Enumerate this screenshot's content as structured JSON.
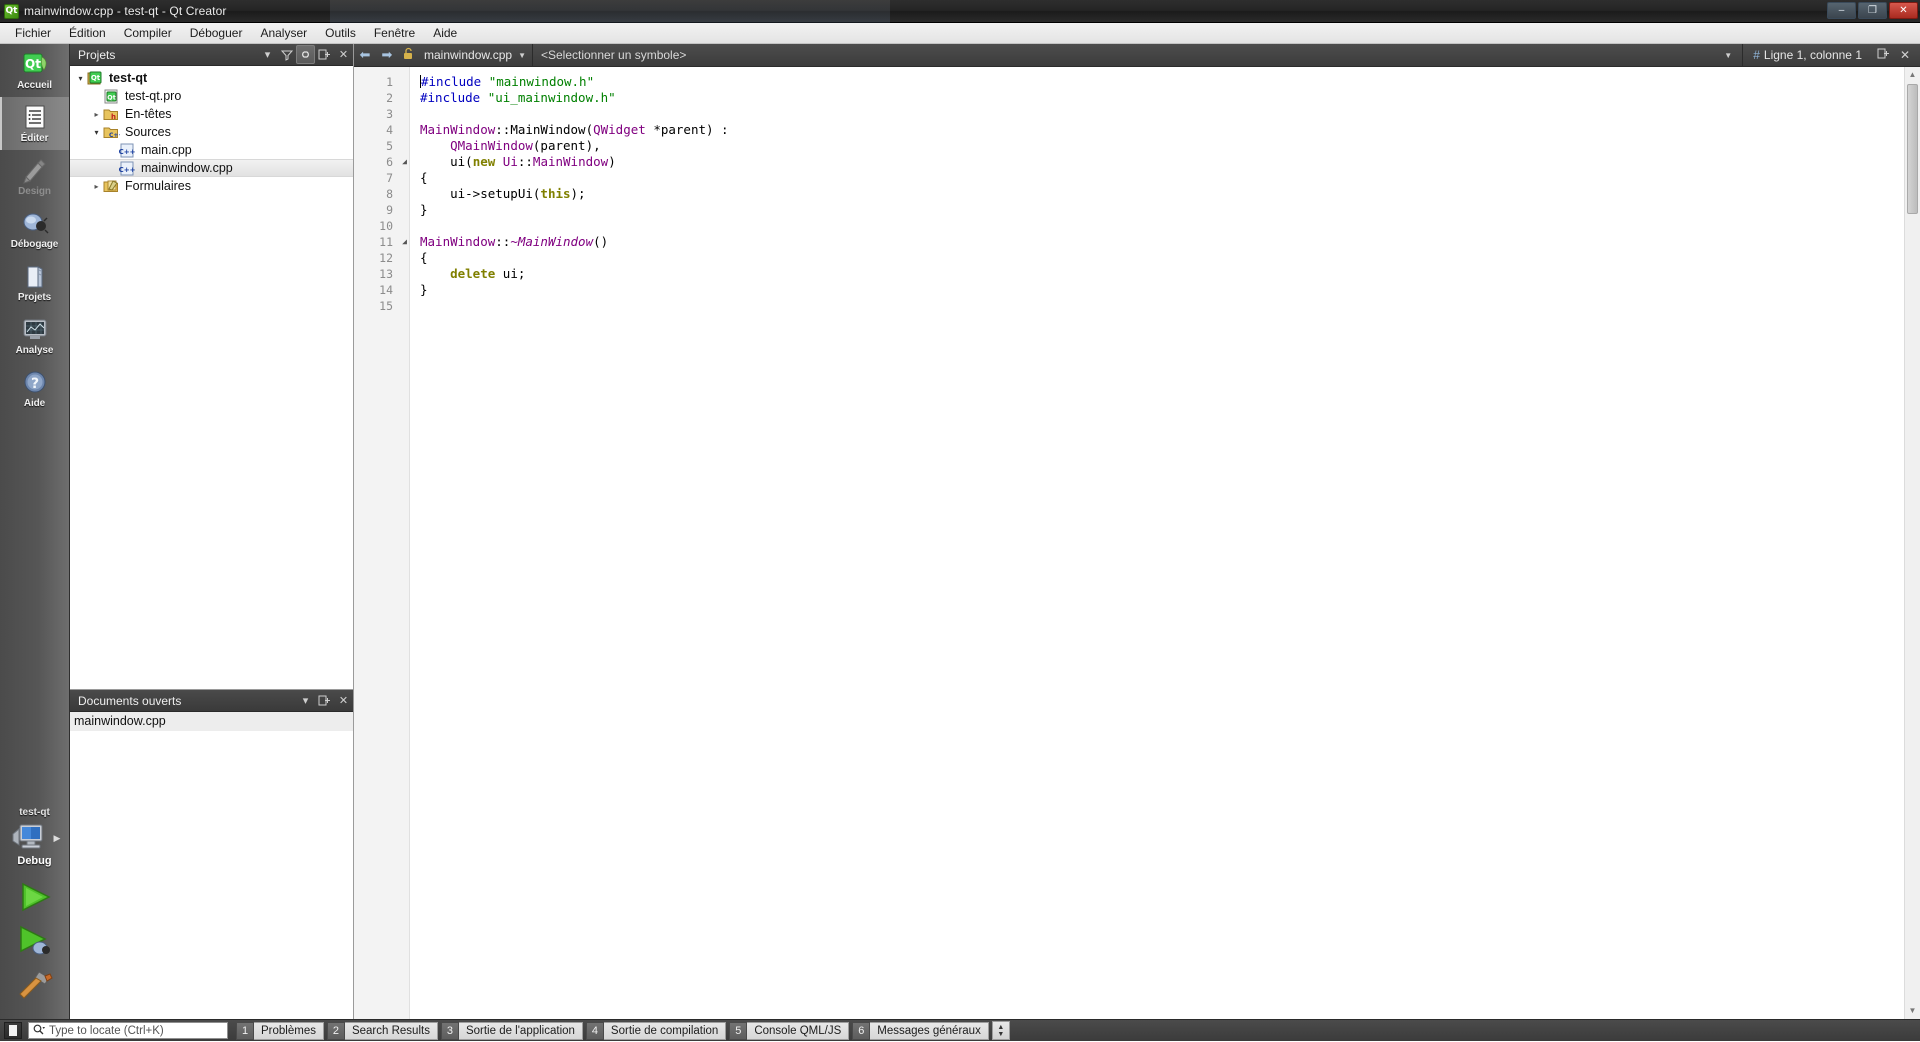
{
  "window": {
    "title": "mainwindow.cpp - test-qt - Qt Creator",
    "app_icon": "qt-logo-icon",
    "minimize_label": "–",
    "maximize_label": "❐",
    "close_label": "✕"
  },
  "menubar": {
    "items": [
      {
        "label": "Fichier"
      },
      {
        "label": "Édition"
      },
      {
        "label": "Compiler"
      },
      {
        "label": "Déboguer"
      },
      {
        "label": "Analyser"
      },
      {
        "label": "Outils"
      },
      {
        "label": "Fenêtre"
      },
      {
        "label": "Aide"
      }
    ]
  },
  "modebar": {
    "modes": [
      {
        "label": "Accueil",
        "icon": "qt-home-icon",
        "selected": false,
        "enabled": true
      },
      {
        "label": "Éditer",
        "icon": "document-edit-icon",
        "selected": true,
        "enabled": true
      },
      {
        "label": "Design",
        "icon": "design-brush-icon",
        "selected": false,
        "enabled": false
      },
      {
        "label": "Débogage",
        "icon": "debug-bug-icon",
        "selected": false,
        "enabled": true
      },
      {
        "label": "Projets",
        "icon": "projects-folder-icon",
        "selected": false,
        "enabled": true
      },
      {
        "label": "Analyse",
        "icon": "analyze-monitor-icon",
        "selected": false,
        "enabled": true
      },
      {
        "label": "Aide",
        "icon": "help-question-icon",
        "selected": false,
        "enabled": true
      }
    ],
    "kit_name": "test-qt",
    "build_config": "Debug",
    "target_selector_icon": "computer-icon",
    "run_button_icon": "green-play-icon",
    "debug_button_icon": "play-bug-icon",
    "build_button_icon": "hammer-icon"
  },
  "projects_dock": {
    "title": "Projets",
    "filter_icon": "filter-icon",
    "sync_icon": "link-sync-icon",
    "split_icon": "split-pane-icon",
    "close_icon": "close-icon",
    "dropdown_icon": "chevron-down-icon",
    "tree": [
      {
        "label": "test-qt",
        "icon": "qt-project-icon",
        "indent": 0,
        "arrow": "open",
        "bold": true,
        "selected": false
      },
      {
        "label": "test-qt.pro",
        "icon": "qt-pro-file-icon",
        "indent": 1,
        "arrow": "none",
        "bold": false,
        "selected": false
      },
      {
        "label": "En-têtes",
        "icon": "folder-h-icon",
        "indent": 1,
        "arrow": "closed",
        "bold": false,
        "selected": false
      },
      {
        "label": "Sources",
        "icon": "folder-cpp-icon",
        "indent": 1,
        "arrow": "open",
        "bold": false,
        "selected": false
      },
      {
        "label": "main.cpp",
        "icon": "cpp-file-icon",
        "indent": 2,
        "arrow": "none",
        "bold": false,
        "selected": false
      },
      {
        "label": "mainwindow.cpp",
        "icon": "cpp-file-icon",
        "indent": 2,
        "arrow": "none",
        "bold": false,
        "selected": true
      },
      {
        "label": "Formulaires",
        "icon": "folder-ui-icon",
        "indent": 1,
        "arrow": "closed",
        "bold": false,
        "selected": false
      }
    ]
  },
  "opendocs_dock": {
    "title": "Documents ouverts",
    "dropdown_icon": "chevron-down-icon",
    "split_icon": "split-pane-icon",
    "close_icon": "close-icon",
    "items": [
      {
        "label": "mainwindow.cpp",
        "selected": true
      }
    ]
  },
  "editor_toolbar": {
    "back_icon": "arrow-back-icon",
    "forward_icon": "arrow-forward-icon",
    "lock_icon": "unlocked-icon",
    "file_name": "mainwindow.cpp",
    "file_dropdown_icon": "chevron-down-icon",
    "symbol_placeholder": "<Selectionner un symbole>",
    "symbol_dropdown_icon": "chevron-down-icon",
    "line_marker": "#",
    "cursor_position": "Ligne 1, colonne 1",
    "split_icon": "split-pane-icon",
    "close_icon": "close-icon"
  },
  "editor": {
    "line_numbers": [
      1,
      2,
      3,
      4,
      5,
      6,
      7,
      8,
      9,
      10,
      11,
      12,
      13,
      14,
      15
    ],
    "fold_markers": {
      "6": "◢",
      "11": "◢"
    },
    "lines": [
      {
        "n": 1,
        "tokens": [
          {
            "t": "#include ",
            "c": "k-pre"
          },
          {
            "t": "\"mainwindow.h\"",
            "c": "k-str"
          }
        ]
      },
      {
        "n": 2,
        "tokens": [
          {
            "t": "#include ",
            "c": "k-pre"
          },
          {
            "t": "\"ui_mainwindow.h\"",
            "c": "k-str"
          }
        ]
      },
      {
        "n": 3,
        "tokens": []
      },
      {
        "n": 4,
        "tokens": [
          {
            "t": "MainWindow",
            "c": "k-type"
          },
          {
            "t": "::MainWindow(",
            "c": ""
          },
          {
            "t": "QWidget",
            "c": "k-type"
          },
          {
            "t": " *parent) :",
            "c": ""
          }
        ]
      },
      {
        "n": 5,
        "tokens": [
          {
            "t": "    ",
            "c": ""
          },
          {
            "t": "QMainWindow",
            "c": "k-type"
          },
          {
            "t": "(parent),",
            "c": ""
          }
        ]
      },
      {
        "n": 6,
        "tokens": [
          {
            "t": "    ui(",
            "c": ""
          },
          {
            "t": "new",
            "c": "k-kw"
          },
          {
            "t": " ",
            "c": ""
          },
          {
            "t": "Ui",
            "c": "k-type"
          },
          {
            "t": "::",
            "c": ""
          },
          {
            "t": "MainWindow",
            "c": "k-type"
          },
          {
            "t": ")",
            "c": ""
          }
        ]
      },
      {
        "n": 7,
        "tokens": [
          {
            "t": "{",
            "c": ""
          }
        ]
      },
      {
        "n": 8,
        "tokens": [
          {
            "t": "    ui->setupUi(",
            "c": ""
          },
          {
            "t": "this",
            "c": "k-kw"
          },
          {
            "t": ");",
            "c": ""
          }
        ]
      },
      {
        "n": 9,
        "tokens": [
          {
            "t": "}",
            "c": ""
          }
        ]
      },
      {
        "n": 10,
        "tokens": []
      },
      {
        "n": 11,
        "tokens": [
          {
            "t": "MainWindow",
            "c": "k-type"
          },
          {
            "t": "::",
            "c": ""
          },
          {
            "t": "~MainWindow",
            "c": "k-type k-it"
          },
          {
            "t": "()",
            "c": ""
          }
        ]
      },
      {
        "n": 12,
        "tokens": [
          {
            "t": "{",
            "c": ""
          }
        ]
      },
      {
        "n": 13,
        "tokens": [
          {
            "t": "    ",
            "c": ""
          },
          {
            "t": "delete",
            "c": "k-kw"
          },
          {
            "t": " ui;",
            "c": ""
          }
        ]
      },
      {
        "n": 14,
        "tokens": [
          {
            "t": "}",
            "c": ""
          }
        ]
      },
      {
        "n": 15,
        "tokens": []
      }
    ]
  },
  "statusbar": {
    "sidebar_toggle_icon": "sidebar-toggle-icon",
    "locate_placeholder": "Type to locate (Ctrl+K)",
    "locate_value": "",
    "locate_icon": "search-icon",
    "output_panes": [
      {
        "num": "1",
        "label": "Problèmes"
      },
      {
        "num": "2",
        "label": "Search Results"
      },
      {
        "num": "3",
        "label": "Sortie de l'application"
      },
      {
        "num": "4",
        "label": "Sortie de compilation"
      },
      {
        "num": "5",
        "label": "Console QML/JS"
      },
      {
        "num": "6",
        "label": "Messages généraux"
      }
    ],
    "updown_icon": "up-down-arrows-icon"
  },
  "colors": {
    "accent_green": "#41cd52",
    "chrome_dark": "#3c3c3c",
    "selection": "#ededed",
    "string_green": "#008000",
    "type_purple": "#800080",
    "preproc_blue": "#0000c0",
    "keyword_olive": "#808000"
  }
}
